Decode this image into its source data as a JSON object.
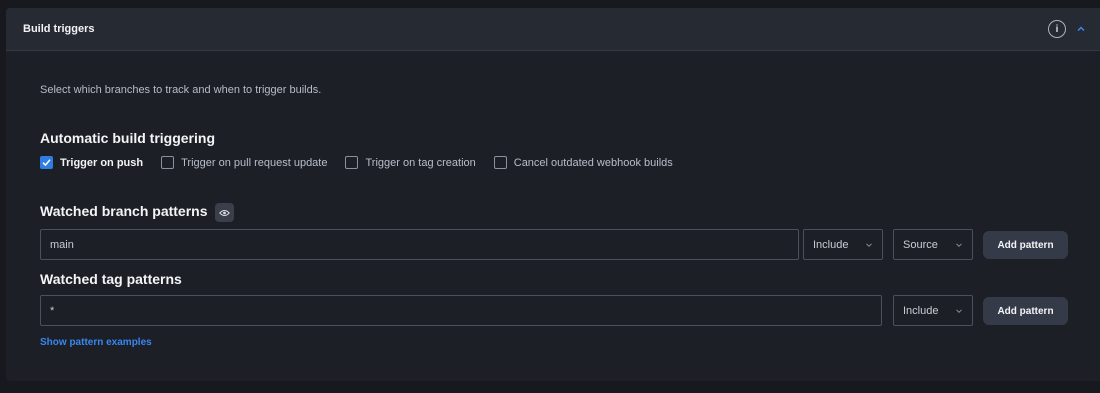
{
  "header": {
    "title": "Build triggers",
    "info_icon": "info-circle-icon",
    "collapse_icon": "chevron-up-icon"
  },
  "description": "Select which branches to track and when to trigger builds.",
  "automatic": {
    "title": "Automatic build triggering",
    "options": [
      {
        "label": "Trigger on push",
        "checked": true
      },
      {
        "label": "Trigger on pull request update",
        "checked": false
      },
      {
        "label": "Trigger on tag creation",
        "checked": false
      },
      {
        "label": "Cancel outdated webhook builds",
        "checked": false
      }
    ]
  },
  "branch_patterns": {
    "title": "Watched branch patterns",
    "title_icon": "eye-icon",
    "value": "main",
    "mode": "Include",
    "scope": "Source",
    "add_label": "Add pattern"
  },
  "tag_patterns": {
    "title": "Watched tag patterns",
    "value": "*",
    "mode": "Include",
    "add_label": "Add pattern"
  },
  "examples_link": "Show pattern examples",
  "colors": {
    "accent": "#2f7de1",
    "link": "#3a86f0",
    "panel": "#1c1f26",
    "header": "#262a33"
  }
}
